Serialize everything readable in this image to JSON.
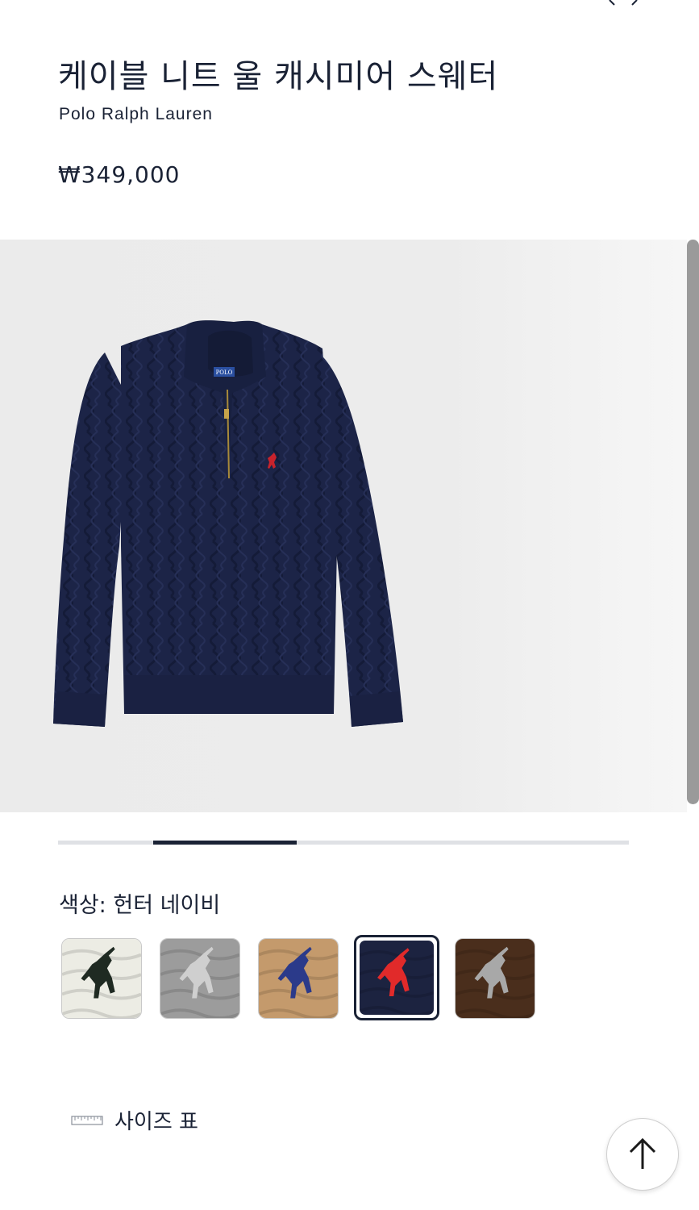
{
  "product": {
    "title": "케이블 니트 울 캐시미어 스웨터",
    "brand": "Polo Ralph Lauren",
    "price": "₩349,000"
  },
  "gallery": {
    "image_progress": 0.4,
    "background_color": "#ebebeb",
    "sweater_color": "#1c2447",
    "logo_color": "#c8232c"
  },
  "color_selector": {
    "label_prefix": "색상:",
    "selected_name": "헌터 네이비",
    "swatches": [
      {
        "name": "swatch-cream",
        "bg": "#ecece4",
        "pony": "#1f2a22",
        "selected": false
      },
      {
        "name": "swatch-grey",
        "bg": "#9c9c9c",
        "pony": "#cfcfcf",
        "selected": false
      },
      {
        "name": "swatch-camel",
        "bg": "#c49a6c",
        "pony": "#2b3a8a",
        "selected": false
      },
      {
        "name": "swatch-hunter-navy",
        "bg": "#1c2340",
        "pony": "#e12a2a",
        "selected": true
      },
      {
        "name": "swatch-brown",
        "bg": "#4a2e1c",
        "pony": "#a8a8a8",
        "selected": false
      }
    ]
  },
  "size_chart": {
    "label": "사이즈 표",
    "icon": "ruler-icon"
  },
  "back_to_top": {
    "icon": "arrow-up-icon"
  }
}
